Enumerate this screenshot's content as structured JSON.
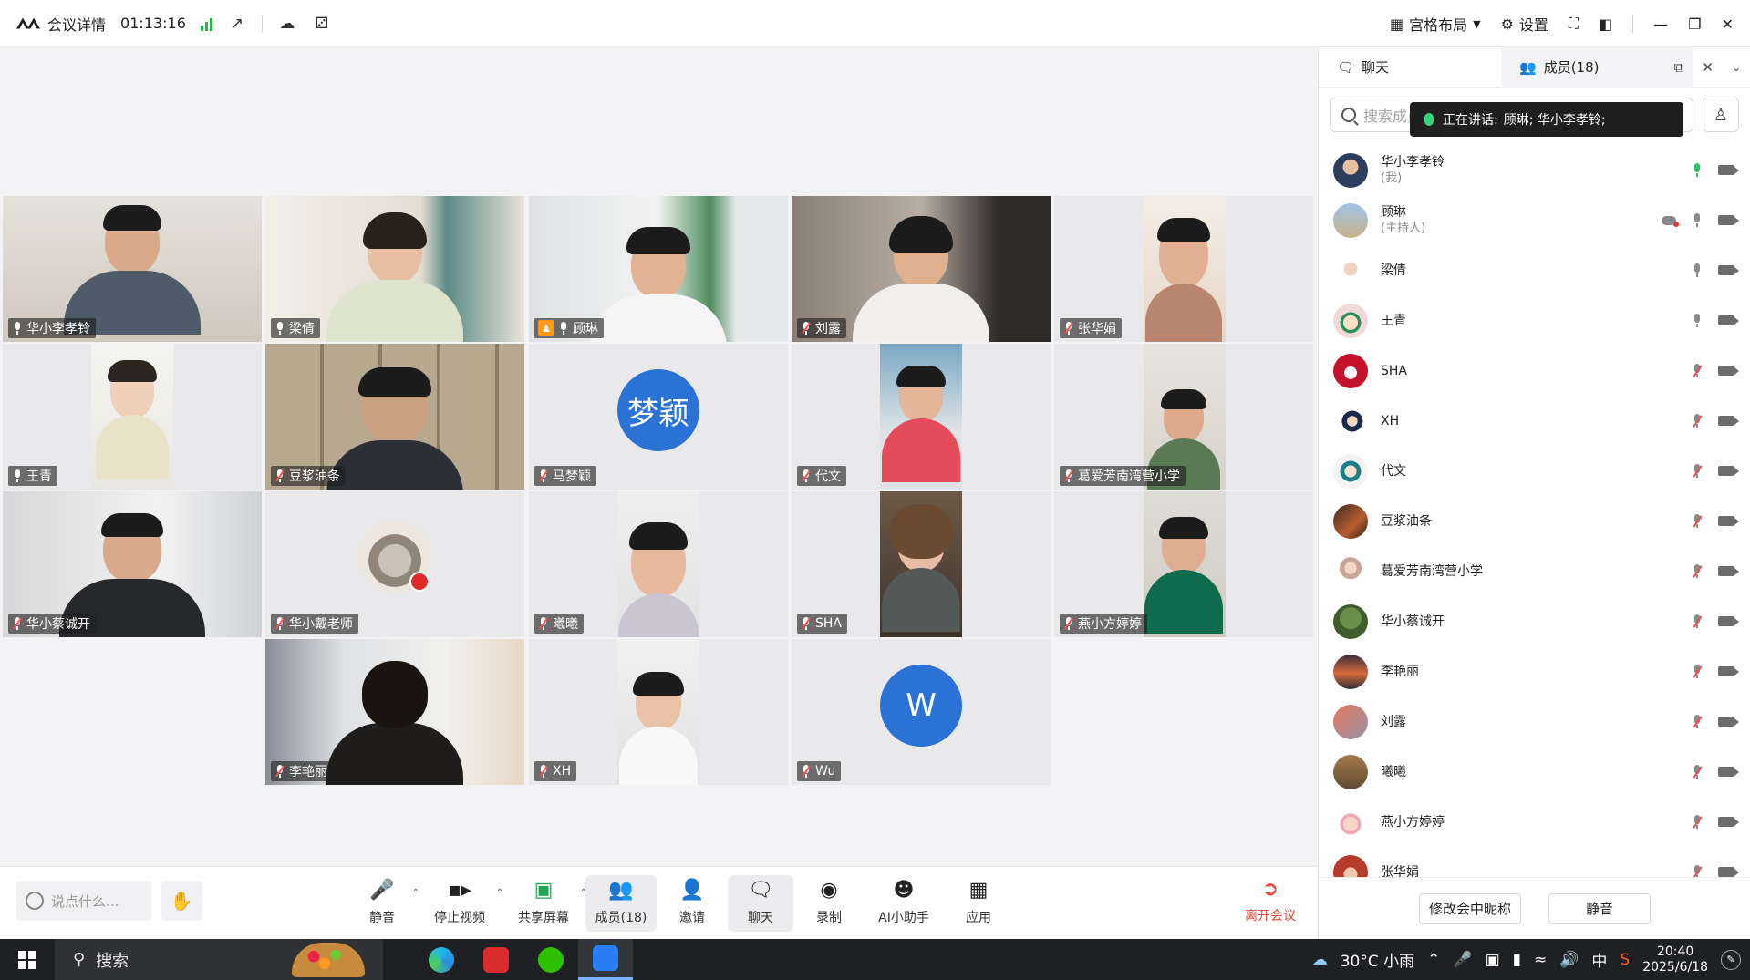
{
  "topbar": {
    "title": "会议详情",
    "elapsed": "01:13:16",
    "layout_label": "宫格布局",
    "settings_label": "设置"
  },
  "tiles": [
    {
      "name": "华小李孝铃",
      "mic": "on"
    },
    {
      "name": "梁倩",
      "mic": "on"
    },
    {
      "name": "顾琳",
      "mic": "on",
      "host": true,
      "active": true
    },
    {
      "name": "刘露",
      "mic": "off"
    },
    {
      "name": "张华娟",
      "mic": "off"
    },
    {
      "name": "王青",
      "mic": "on"
    },
    {
      "name": "豆浆油条",
      "mic": "off"
    },
    {
      "name": "马梦颖",
      "mic": "off",
      "avatar_text": "梦颖"
    },
    {
      "name": "代文",
      "mic": "off"
    },
    {
      "name": "葛爱芳南湾营小学",
      "mic": "off"
    },
    {
      "name": "华小蔡诚开",
      "mic": "off"
    },
    {
      "name": "华小戴老师",
      "mic": "off"
    },
    {
      "name": "曦曦",
      "mic": "off"
    },
    {
      "name": "SHA",
      "mic": "off"
    },
    {
      "name": "燕小方婷婷",
      "mic": "off"
    },
    {
      "name": "李艳丽",
      "mic": "off"
    },
    {
      "name": "XH",
      "mic": "off"
    },
    {
      "name": "Wu",
      "mic": "off",
      "avatar_text": "W"
    }
  ],
  "bottombar": {
    "chat_placeholder": "说点什么...",
    "mute": "静音",
    "stop_video": "停止视频",
    "share": "共享屏幕",
    "members": "成员(18)",
    "invite": "邀请",
    "chat": "聊天",
    "record": "录制",
    "ai": "AI小助手",
    "apps": "应用",
    "leave": "离开会议"
  },
  "panel": {
    "tab_chat": "聊天",
    "tab_members": "成员(18)",
    "search_placeholder": "搜索成员",
    "speaking_label": "正在讲话:",
    "speaking_names": "顾琳; 华小李孝铃;",
    "members": [
      {
        "name": "华小李孝铃",
        "sub": "(我)",
        "mic": "on"
      },
      {
        "name": "顾琳",
        "sub": "(主持人)",
        "mic": "idle",
        "cloud": true
      },
      {
        "name": "梁倩",
        "mic": "idle"
      },
      {
        "name": "王青",
        "mic": "idle"
      },
      {
        "name": "SHA",
        "mic": "off"
      },
      {
        "name": "XH",
        "mic": "off"
      },
      {
        "name": "代文",
        "mic": "off"
      },
      {
        "name": "豆浆油条",
        "mic": "off"
      },
      {
        "name": "葛爱芳南湾营小学",
        "mic": "off"
      },
      {
        "name": "华小蔡诚开",
        "mic": "off"
      },
      {
        "name": "李艳丽",
        "mic": "off"
      },
      {
        "name": "刘露",
        "mic": "off"
      },
      {
        "name": "曦曦",
        "mic": "off"
      },
      {
        "name": "燕小方婷婷",
        "mic": "off"
      },
      {
        "name": "张华娟",
        "mic": "off"
      }
    ],
    "rename_button": "修改会中昵称",
    "mute_button": "静音"
  },
  "taskbar": {
    "search": "搜索",
    "weather": "30°C 小雨",
    "ime": "中",
    "time": "20:40",
    "date": "2025/6/18"
  }
}
